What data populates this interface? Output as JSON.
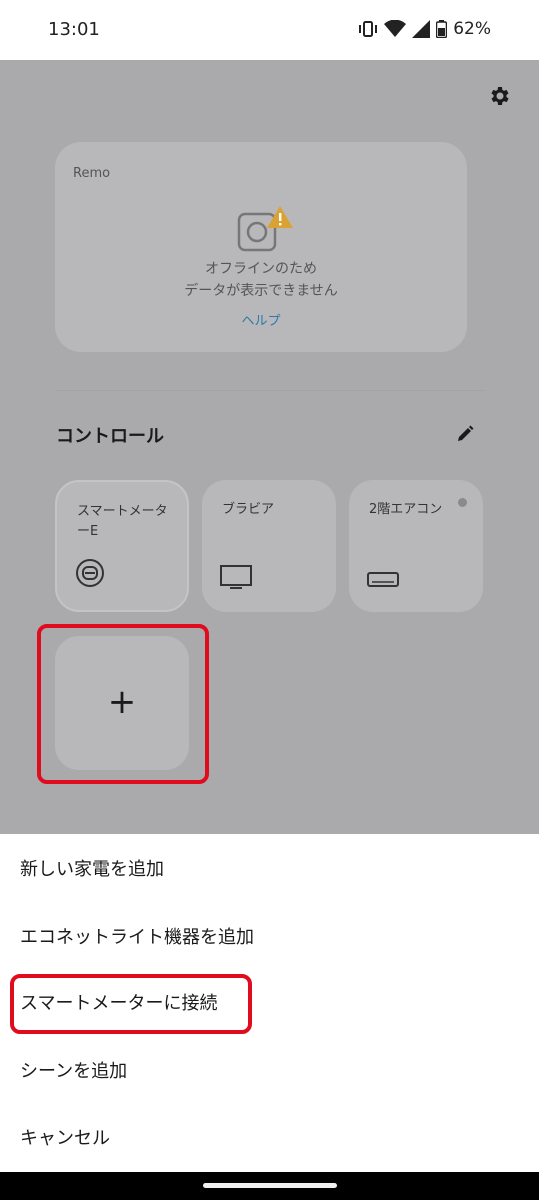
{
  "status_bar": {
    "time": "13:01",
    "battery": "62%",
    "icons": [
      "vibrate-icon",
      "wifi-icon",
      "signal-icon",
      "battery-icon"
    ]
  },
  "remo_card": {
    "title": "Remo",
    "message_line1": "オフラインのため",
    "message_line2": "データが表示できません",
    "help_link": "ヘルプ"
  },
  "controls": {
    "section_title": "コントロール",
    "tiles": [
      {
        "label": "スマートメーターE",
        "icon": "smart-meter-icon"
      },
      {
        "label": "ブラビア",
        "icon": "tv-icon"
      },
      {
        "label": "2階エアコン",
        "icon": "air-conditioner-icon"
      }
    ],
    "add_symbol": "+"
  },
  "sheet": {
    "items": [
      "新しい家電を追加",
      "エコネットライト機器を追加",
      "スマートメーターに接続",
      "シーンを追加",
      "キャンセル"
    ]
  },
  "colors": {
    "highlight": "#e00b1c",
    "link": "#2e7aa3",
    "warning": "#d9a233",
    "dimmed_background": "#aaaaad"
  }
}
